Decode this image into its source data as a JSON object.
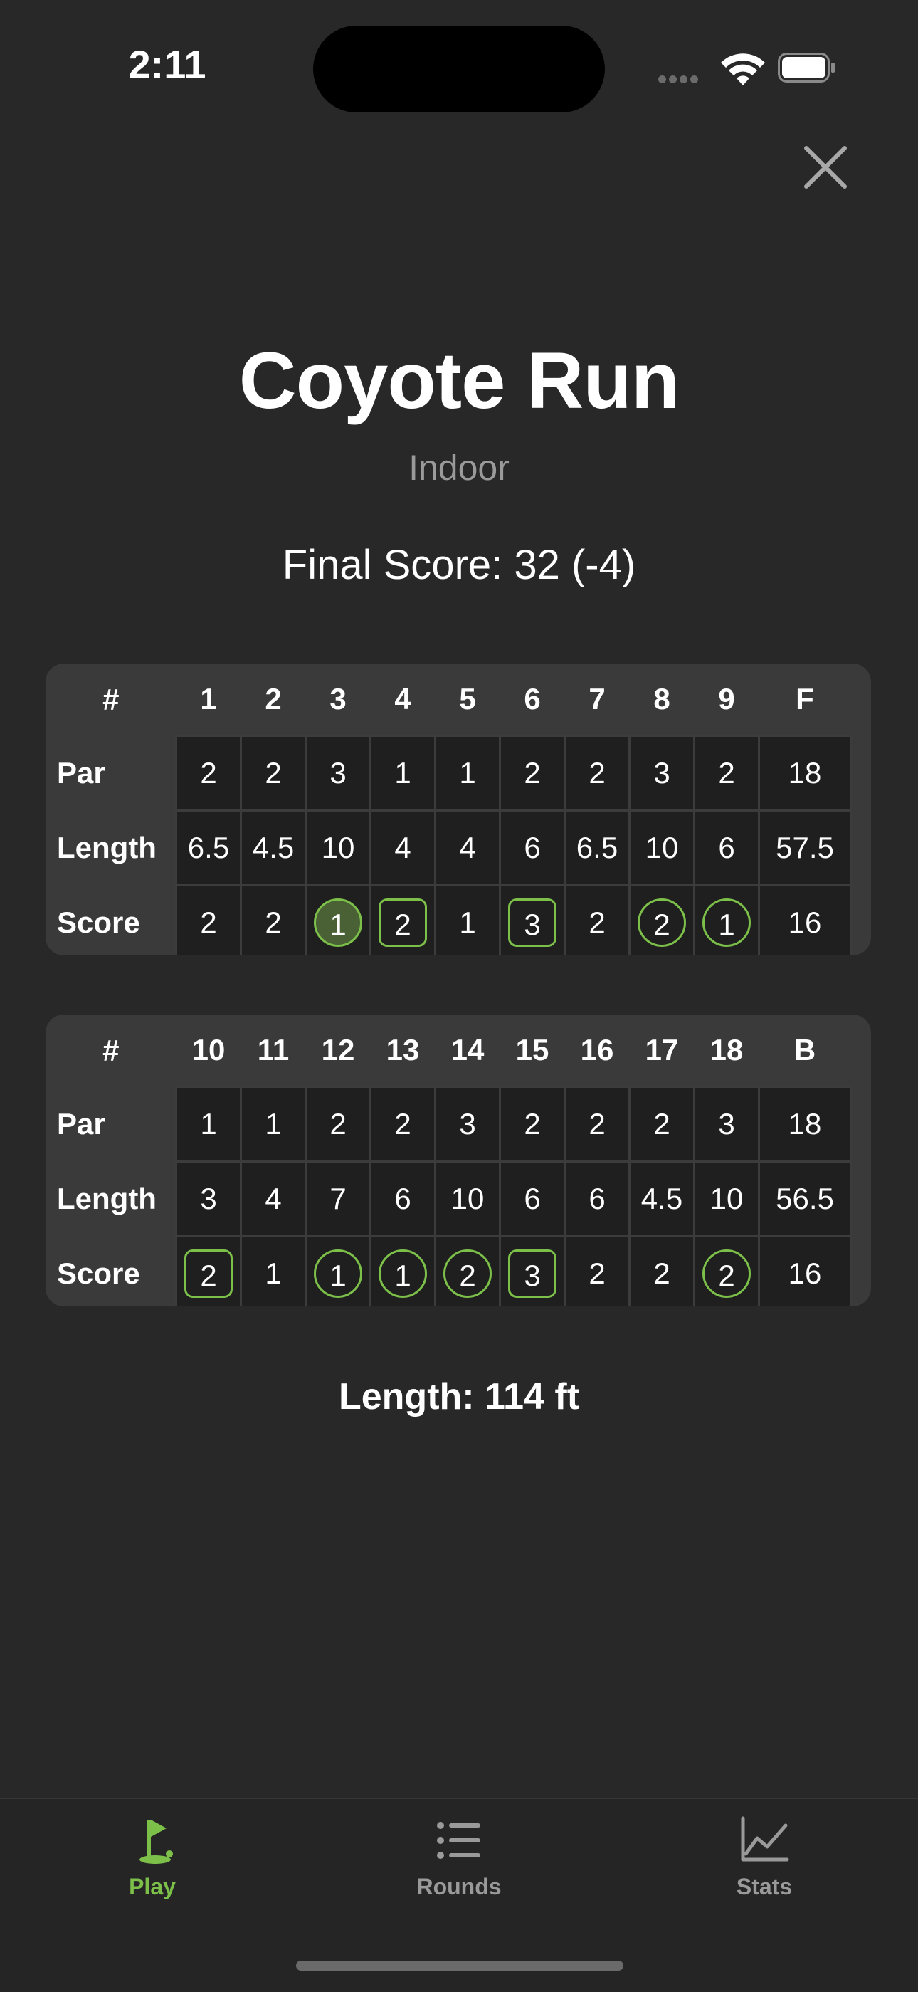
{
  "status_bar": {
    "time": "2:11"
  },
  "course": {
    "name": "Coyote Run",
    "type": "Indoor",
    "final_score": "Final Score: 32 (-4)"
  },
  "front_nine": {
    "header": [
      "#",
      "1",
      "2",
      "3",
      "4",
      "5",
      "6",
      "7",
      "8",
      "9",
      "F"
    ],
    "rows": [
      {
        "label": "Par",
        "values": [
          "2",
          "2",
          "3",
          "1",
          "1",
          "2",
          "2",
          "3",
          "2",
          "18"
        ]
      },
      {
        "label": "Length",
        "values": [
          "6.5",
          "4.5",
          "10",
          "4",
          "4",
          "6",
          "6.5",
          "10",
          "6",
          "57.5"
        ]
      },
      {
        "label": "Score",
        "values": [
          "2",
          "2",
          "1",
          "2",
          "1",
          "3",
          "2",
          "2",
          "1",
          "16"
        ],
        "marks": [
          "",
          "",
          "circle-fill",
          "square",
          "",
          "square",
          "",
          "circle",
          "circle",
          ""
        ]
      }
    ]
  },
  "back_nine": {
    "header": [
      "#",
      "10",
      "11",
      "12",
      "13",
      "14",
      "15",
      "16",
      "17",
      "18",
      "B"
    ],
    "rows": [
      {
        "label": "Par",
        "values": [
          "1",
          "1",
          "2",
          "2",
          "3",
          "2",
          "2",
          "2",
          "3",
          "18"
        ]
      },
      {
        "label": "Length",
        "values": [
          "3",
          "4",
          "7",
          "6",
          "10",
          "6",
          "6",
          "4.5",
          "10",
          "56.5"
        ]
      },
      {
        "label": "Score",
        "values": [
          "2",
          "1",
          "1",
          "1",
          "2",
          "3",
          "2",
          "2",
          "2",
          "16"
        ],
        "marks": [
          "square",
          "",
          "circle",
          "circle",
          "circle",
          "square",
          "",
          "",
          "circle",
          ""
        ]
      }
    ]
  },
  "total_length": "Length: 114 ft",
  "tabs": [
    {
      "label": "Play",
      "icon": "golf-flag-icon",
      "active": true
    },
    {
      "label": "Rounds",
      "icon": "list-icon",
      "active": false
    },
    {
      "label": "Stats",
      "icon": "chart-line-icon",
      "active": false
    }
  ],
  "colors": {
    "accent": "#7cc04a",
    "background": "#282828",
    "card": "#3a3a3a",
    "cell": "#1f1f1f"
  }
}
